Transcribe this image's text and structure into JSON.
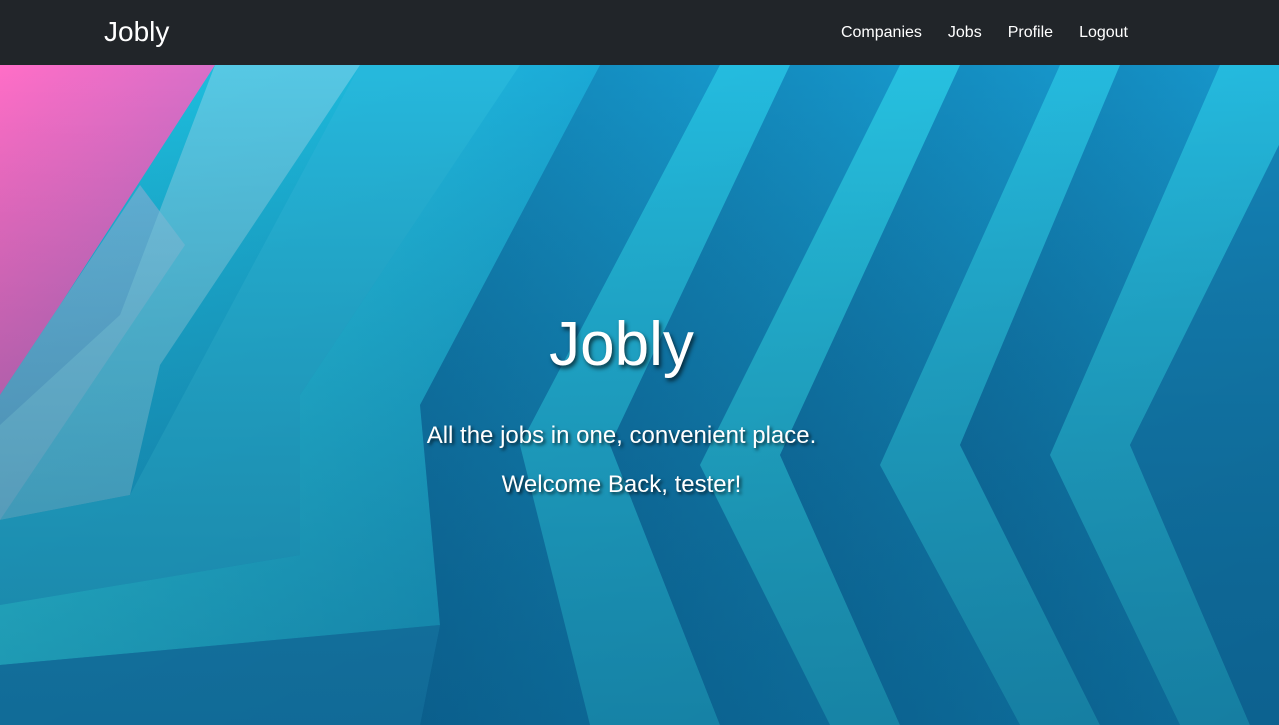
{
  "navbar": {
    "brand": "Jobly",
    "links": [
      {
        "label": "Companies"
      },
      {
        "label": "Jobs"
      },
      {
        "label": "Profile"
      },
      {
        "label": "Logout"
      }
    ],
    "background": "#212529"
  },
  "hero": {
    "title": "Jobly",
    "tagline": "All the jobs in one, convenient place.",
    "welcome": "Welcome Back, tester!",
    "colors": {
      "pink": "#ec5fb8",
      "cyan": "#22c4e0",
      "blue": "#1a8fc4",
      "deep_blue": "#0e6a9c"
    }
  }
}
